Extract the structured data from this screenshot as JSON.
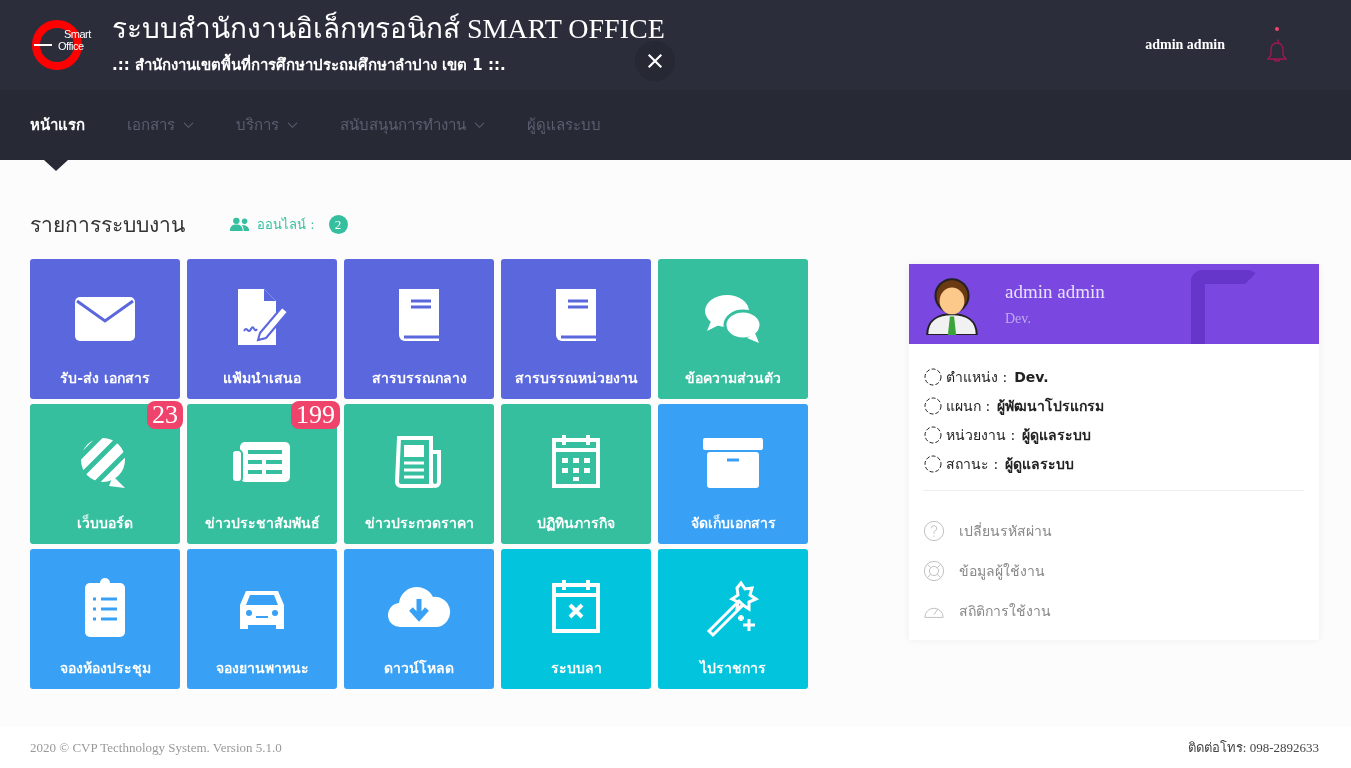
{
  "header": {
    "logo": {
      "line1": "Smart",
      "line2": "Office"
    },
    "title": "ระบบสำนักงานอิเล็กทรอนิกส์ SMART OFFICE",
    "subtitle": ".:: สำนักงานเขตพื้นที่การศึกษาประถมศึกษาลำปาง เขต 1 ::.",
    "user": "admin admin",
    "notification": true
  },
  "nav": [
    {
      "label": "หน้าแรก",
      "selected": true,
      "dropdown": false
    },
    {
      "label": "เอกสาร",
      "selected": false,
      "dropdown": true
    },
    {
      "label": "บริการ",
      "selected": false,
      "dropdown": true
    },
    {
      "label": "สนับสนุนการทำงาน",
      "selected": false,
      "dropdown": true
    },
    {
      "label": "ผู้ดูแลระบบ",
      "selected": false,
      "dropdown": false
    }
  ],
  "section": {
    "title": "รายการระบบงาน",
    "online_label": "ออนไลน์ :",
    "online_count": "2"
  },
  "tiles": [
    {
      "label": "รับ-ส่ง เอกสาร",
      "kind": "envelope",
      "color": "#5a67dd"
    },
    {
      "label": "แฟ้มนำเสนอ",
      "kind": "doc-pen",
      "color": "#5a67dd"
    },
    {
      "label": "สารบรรณกลาง",
      "kind": "book",
      "color": "#5a67dd"
    },
    {
      "label": "สารบรรณหน่วยงาน",
      "kind": "book",
      "color": "#5a67dd"
    },
    {
      "label": "ข้อความส่วนตัว",
      "kind": "chat",
      "color": "#35bf9f"
    },
    {
      "label": "เว็บบอร์ด",
      "kind": "stripes",
      "color": "#35bf9f",
      "badge": "23"
    },
    {
      "label": "ข่าวประชาสัมพันธ์",
      "kind": "newspaper",
      "color": "#35bf9f",
      "badge": "199"
    },
    {
      "label": "ข่าวประกวดราคา",
      "kind": "news",
      "color": "#35bf9f"
    },
    {
      "label": "ปฏิทินภารกิจ",
      "kind": "calendar",
      "color": "#35bf9f"
    },
    {
      "label": "จัดเก็บเอกสาร",
      "kind": "archive",
      "color": "#38a1f5"
    },
    {
      "label": "จองห้องประชุม",
      "kind": "clipboard",
      "color": "#38a1f5"
    },
    {
      "label": "จองยานพาหนะ",
      "kind": "car",
      "color": "#38a1f5"
    },
    {
      "label": "ดาวน์โหลด",
      "kind": "cloud",
      "color": "#38a1f5"
    },
    {
      "label": "ระบบลา",
      "kind": "calendar-x",
      "color": "#02c4dd"
    },
    {
      "label": "ไปราชการ",
      "kind": "wand",
      "color": "#02c4dd"
    }
  ],
  "profile": {
    "name": "admin admin",
    "role": "Dev.",
    "info": [
      {
        "label": "ตำแหน่ง :",
        "value": "Dev."
      },
      {
        "label": "แผนก :",
        "value": "ผู้พัฒนาโปรแกรม"
      },
      {
        "label": "หน่วยงาน :",
        "value": "ผู้ดูแลระบบ"
      },
      {
        "label": "สถานะ :",
        "value": "ผู้ดูแลระบบ"
      }
    ],
    "links": [
      {
        "label": "เปลี่ยนรหัสผ่าน",
        "kind": "question"
      },
      {
        "label": "ข้อมูลผู้ใช้งาน",
        "kind": "lifebuoy"
      },
      {
        "label": "สถิติการใช้งาน",
        "kind": "gauge"
      }
    ]
  },
  "footer": {
    "copyright": "2020 © CVP Tecthnology System. Version 5.1.0",
    "contact": "ติดต่อโทร: 098-2892633"
  }
}
